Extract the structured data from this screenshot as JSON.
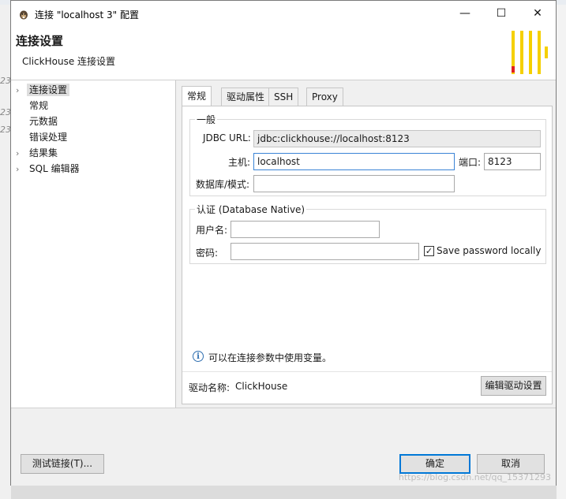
{
  "window": {
    "title": "连接 \"localhost 3\" 配置",
    "controls": {
      "minimize": "—",
      "maximize": "☐",
      "close": "✕"
    }
  },
  "header": {
    "title": "连接设置",
    "subtitle": "ClickHouse 连接设置",
    "logo_colors": [
      "#f5d000",
      "#e02020"
    ]
  },
  "nav": {
    "items": [
      {
        "label": "连接设置",
        "arrow": "›",
        "selected": true
      },
      {
        "label": "常规",
        "arrow": ""
      },
      {
        "label": "元数据",
        "arrow": ""
      },
      {
        "label": "错误处理",
        "arrow": ""
      },
      {
        "label": "结果集",
        "arrow": "›"
      },
      {
        "label": "SQL 编辑器",
        "arrow": "›"
      }
    ]
  },
  "tabs": [
    "常规",
    "驱动属性",
    "SSH",
    "Proxy"
  ],
  "general": {
    "legend": "一般",
    "jdbc_url_label": "JDBC URL:",
    "jdbc_url_value": "jdbc:clickhouse://localhost:8123",
    "host_label": "主机:",
    "host_value": "localhost",
    "port_label": "端口:",
    "port_value": "8123",
    "db_label": "数据库/模式:",
    "db_value": ""
  },
  "auth": {
    "legend": "认证 (Database Native)",
    "username_label": "用户名:",
    "username_value": "",
    "password_label": "密码:",
    "password_value": "",
    "save_password_label": "Save password locally",
    "save_password_checked": "✓"
  },
  "info": {
    "icon": "i",
    "text": "可以在连接参数中使用变量。"
  },
  "driver": {
    "label": "驱动名称:",
    "name": "ClickHouse",
    "edit_button": "编辑驱动设置"
  },
  "buttons": {
    "test": "测试链接(T)...",
    "ok": "确定",
    "cancel": "取消"
  },
  "background": {
    "left_numbers": [
      "23",
      "23",
      "23"
    ]
  },
  "watermark": "https://blog.csdn.net/qq_15371293"
}
